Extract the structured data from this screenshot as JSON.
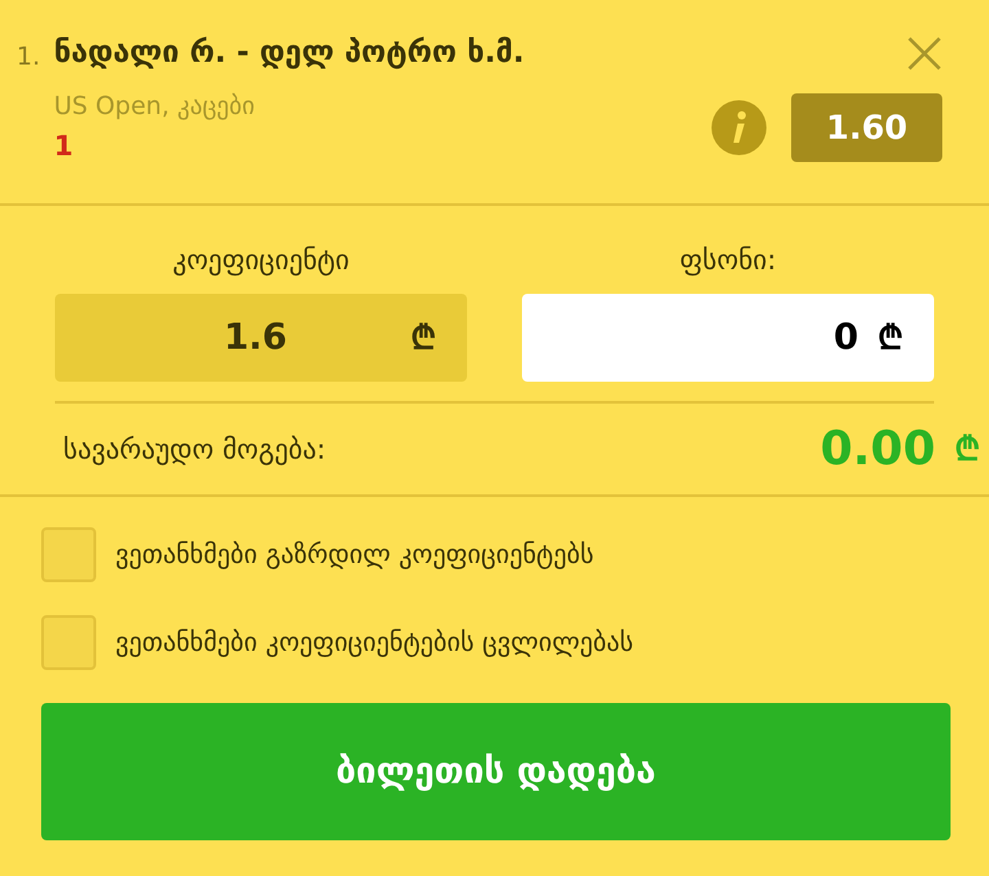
{
  "bet": {
    "number": "1.",
    "title": "ნადალი რ. - დელ პოტრო ხ.მ.",
    "tournament": "US Open, კაცები",
    "pick": "1",
    "odds": "1.60"
  },
  "odds_field": {
    "label": "კოეფიციენტი",
    "value": "1.6",
    "currency": "₾"
  },
  "stake_field": {
    "label": "ფსონი:",
    "value": "0",
    "currency": "₾"
  },
  "possible_win": {
    "label": "სავარაუდო მოგება:",
    "value": "0.00",
    "currency": "₾"
  },
  "agreements": [
    {
      "label": "ვეთანხმები გაზრდილ კოეფიციენტებს",
      "checked": false
    },
    {
      "label": "ვეთანხმები კოეფიციენტების ცვლილებას",
      "checked": false
    }
  ],
  "submit": "ბილეთის დადება"
}
